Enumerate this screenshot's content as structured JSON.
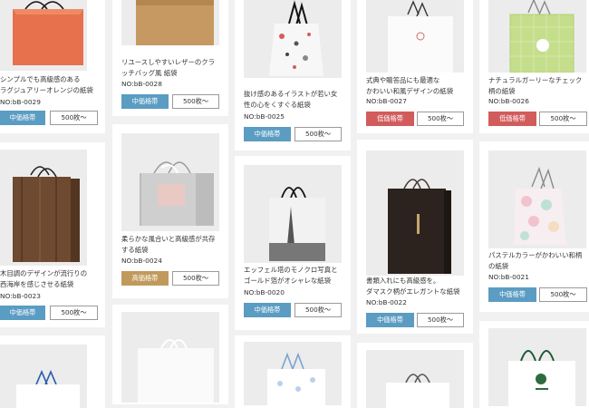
{
  "products": [
    {
      "desc": "シンプルでも高級感のある\nラグジュアリーオレンジの紙袋",
      "code": "NO:bB-0029",
      "price": "中価格帯",
      "qty": "500枚〜"
    },
    {
      "desc": "リユースしやすいレザーのクラ\nッチバッグ風 紙袋",
      "code": "NO:bB-0028",
      "price": "中価格帯",
      "qty": "500枚〜"
    },
    {
      "desc": "抜け感のあるイラストが若い女\n性の心をくすぐる紙袋",
      "code": "NO:bB-0025",
      "price": "中価格帯",
      "qty": "500枚〜"
    },
    {
      "desc": "式典や贈答品にも最適な\nかわいい和風デザインの紙袋",
      "code": "NO:bB-0027",
      "price": "低価格帯",
      "qty": "500枚〜"
    },
    {
      "desc": "ナチュラルガーリーなチェック\n柄の紙袋",
      "code": "NO:bB-0026",
      "price": "低価格帯",
      "qty": "500枚〜"
    },
    {
      "desc": "木目調のデザインが流行りの\n西海岸を感じさせる紙袋",
      "code": "NO:bB-0023",
      "price": "中価格帯",
      "qty": "500枚〜"
    },
    {
      "desc": "柔らかな風合いと高級感が共存\nする紙袋",
      "code": "NO:bB-0024",
      "price": "高価格帯",
      "qty": "500枚〜"
    },
    {
      "desc": "エッフェル塔のモノクロ写真と\nゴールド箔がオシャレな紙袋",
      "code": "NO:bB-0020",
      "price": "中価格帯",
      "qty": "500枚〜"
    },
    {
      "desc": "書類入れにも高級感を。\nダマスク柄がエレガントな紙袋",
      "code": "NO:bB-0022",
      "price": "中価格帯",
      "qty": "500枚〜"
    },
    {
      "desc": "パステルカラーがかわいい和柄\nの紙袋",
      "code": "NO:bB-0021",
      "price": "中価格帯",
      "qty": "500枚〜"
    }
  ]
}
